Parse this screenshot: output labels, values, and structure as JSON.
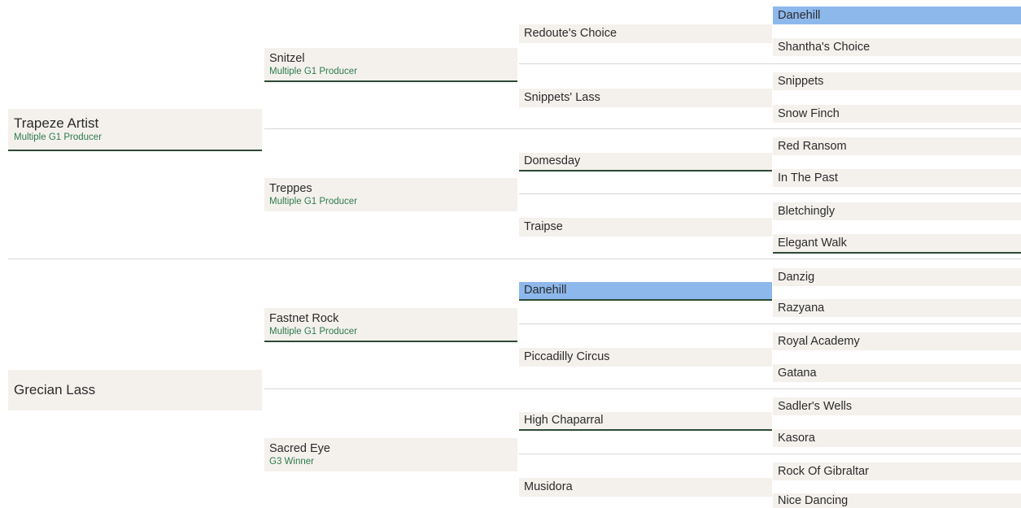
{
  "gen1": [
    {
      "name": "Trapeze Artist",
      "sub": "Multiple G1 Producer"
    },
    {
      "name": "Grecian Lass",
      "sub": ""
    }
  ],
  "gen2": [
    {
      "name": "Snitzel",
      "sub": "Multiple G1 Producer"
    },
    {
      "name": "Treppes",
      "sub": "Multiple G1 Producer"
    },
    {
      "name": "Fastnet Rock",
      "sub": "Multiple G1 Producer"
    },
    {
      "name": "Sacred Eye",
      "sub": "G3 Winner"
    }
  ],
  "gen3": [
    {
      "name": "Redoute's Choice"
    },
    {
      "name": "Snippets' Lass"
    },
    {
      "name": "Domesday"
    },
    {
      "name": "Traipse"
    },
    {
      "name": "Danehill"
    },
    {
      "name": "Piccadilly Circus"
    },
    {
      "name": "High Chaparral"
    },
    {
      "name": "Musidora"
    }
  ],
  "gen4": [
    {
      "name": "Danehill"
    },
    {
      "name": "Shantha's Choice"
    },
    {
      "name": "Snippets"
    },
    {
      "name": "Snow Finch"
    },
    {
      "name": "Red Ransom"
    },
    {
      "name": "In The Past"
    },
    {
      "name": "Bletchingly"
    },
    {
      "name": "Elegant Walk"
    },
    {
      "name": "Danzig"
    },
    {
      "name": "Razyana"
    },
    {
      "name": "Royal Academy"
    },
    {
      "name": "Gatana"
    },
    {
      "name": "Sadler's Wells"
    },
    {
      "name": "Kasora"
    },
    {
      "name": "Rock Of Gibraltar"
    },
    {
      "name": "Nice Dancing"
    }
  ],
  "colors": {
    "cell_bg": "#f4f1ed",
    "highlight": "#8db8ec",
    "underline": "#2d4a37",
    "producer_text": "#2e7a4d"
  }
}
